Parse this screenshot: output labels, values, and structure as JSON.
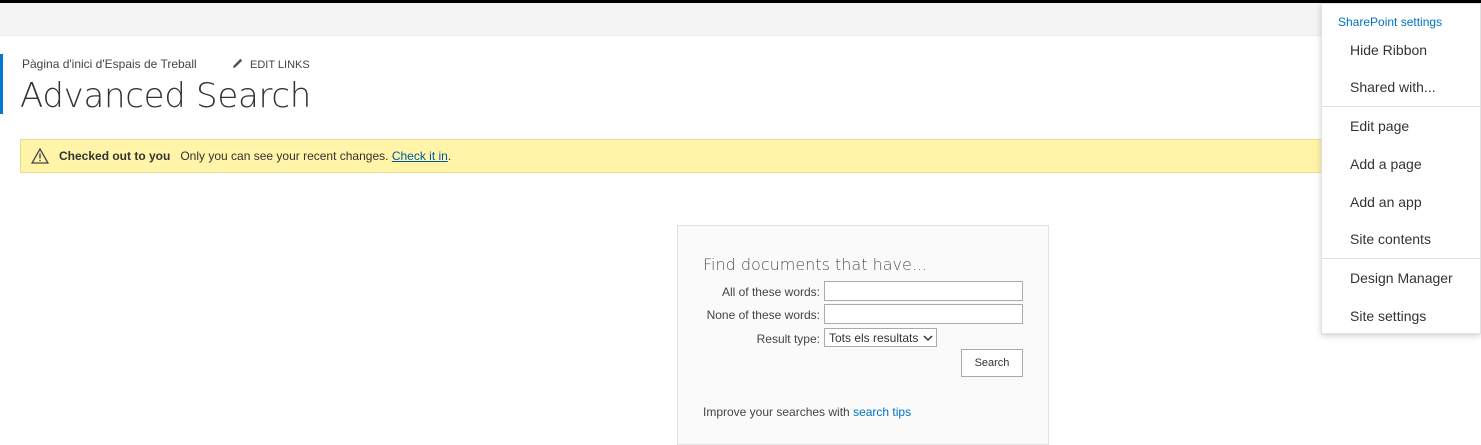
{
  "header": {
    "breadcrumb": "Pàgina d'inici d'Espais de Treball",
    "edit_links_label": "EDIT LINKS",
    "page_title": "Advanced Search"
  },
  "notice": {
    "bold_text": "Checked out to you",
    "message": "Only you can see your recent changes.",
    "link_text": "Check it in",
    "suffix": ".",
    "icon": "warning-icon"
  },
  "search": {
    "heading": "Find documents that have...",
    "all_words_label": "All of these words:",
    "all_words_value": "",
    "none_words_label": "None of these words:",
    "none_words_value": "",
    "result_type_label": "Result type:",
    "result_type_selected": "Tots els resultats",
    "search_button": "Search",
    "improve_text": "Improve your searches with ",
    "tips_link": "search tips"
  },
  "settings_menu": {
    "header": "SharePoint settings",
    "items": [
      "Hide Ribbon",
      "Shared with...",
      "Edit page",
      "Add a page",
      "Add an app",
      "Site contents",
      "Design Manager",
      "Site settings"
    ]
  },
  "colors": {
    "accent": "#0078d4",
    "notice_bg": "#fff4a8",
    "link": "#0072c6"
  }
}
